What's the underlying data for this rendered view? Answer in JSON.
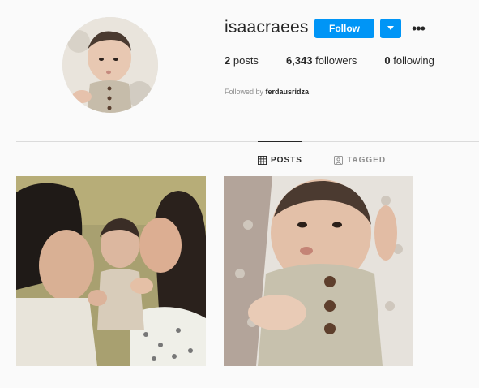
{
  "profile": {
    "username": "isaacraees",
    "follow_label": "Follow",
    "more_label": "•••",
    "stats": {
      "posts_count": "2",
      "posts_label": "posts",
      "followers_count": "6,343",
      "followers_label": "followers",
      "following_count": "0",
      "following_label": "following"
    },
    "followed_by_prefix": "Followed by",
    "followed_by_user": "ferdausridza"
  },
  "tabs": [
    {
      "label": "POSTS",
      "icon": "grid-icon",
      "active": true
    },
    {
      "label": "TAGGED",
      "icon": "tagged-icon",
      "active": false
    }
  ],
  "colors": {
    "accent": "#0095f6",
    "text": "#262626",
    "muted": "#8e8e8e",
    "background": "#fafafa",
    "divider": "#dbdbdb"
  }
}
